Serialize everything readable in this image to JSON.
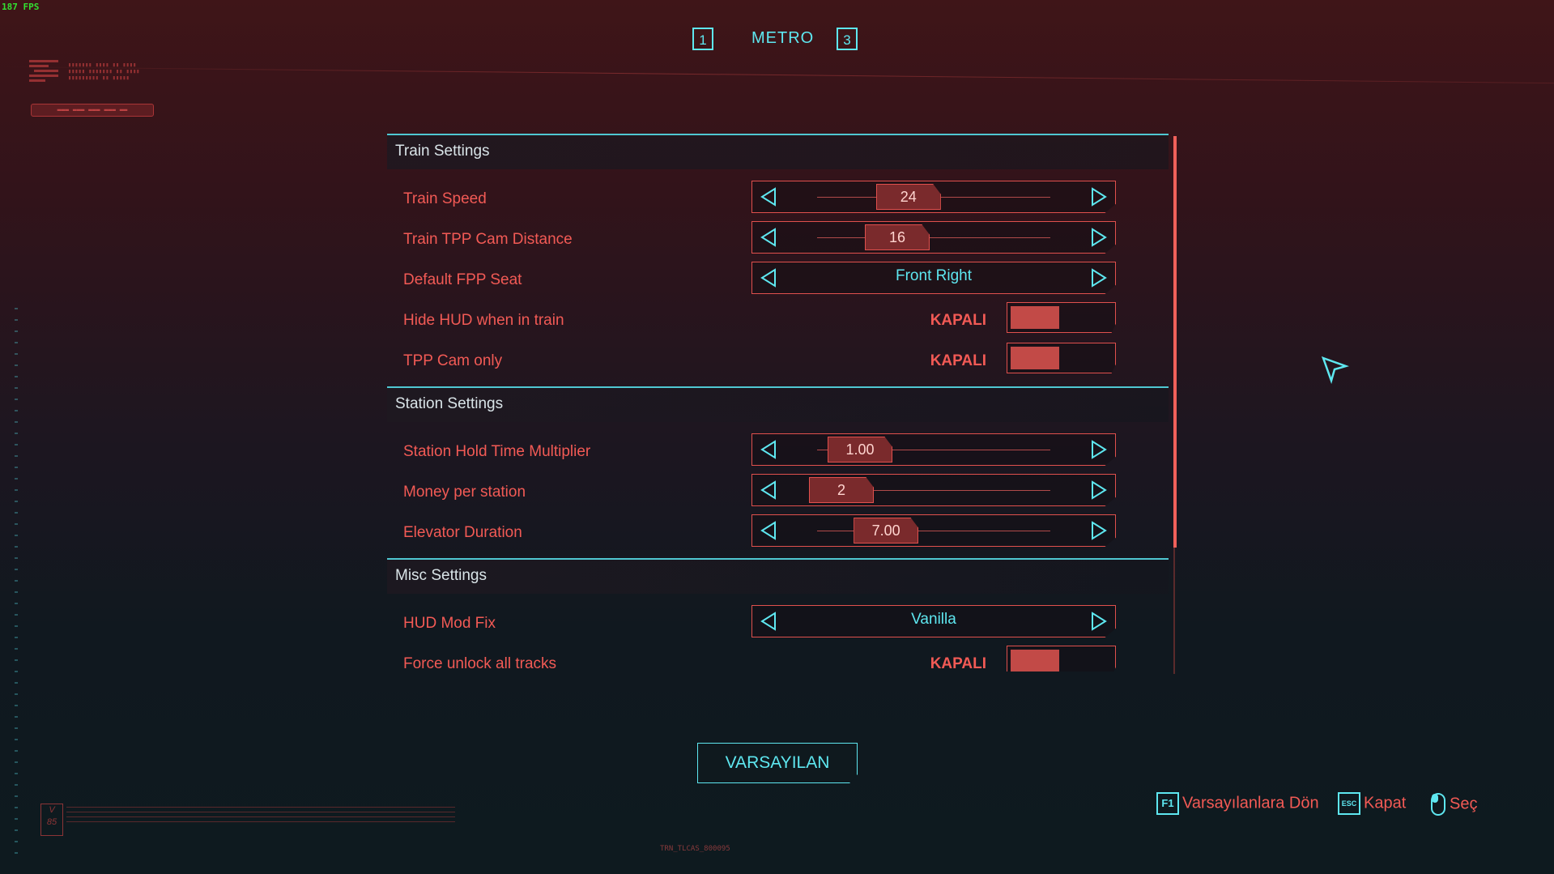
{
  "overlay": {
    "fps": "187 FPS"
  },
  "tabs": {
    "prev_key": "1",
    "title": "METRO",
    "next_key": "3"
  },
  "sections": {
    "train": {
      "title": "Train Settings",
      "rows": {
        "train_speed": {
          "label": "Train Speed",
          "value": "24",
          "fraction": 0.36
        },
        "tpp_cam": {
          "label": "Train TPP Cam Distance",
          "value": "16",
          "fraction": 0.3
        },
        "fpp_seat": {
          "label": "Default FPP Seat",
          "value": "Front Right",
          "selected_index": 0,
          "option_count": 3
        },
        "hide_hud": {
          "label": "Hide HUD when in train",
          "value": "KAPALI"
        },
        "tpp_only": {
          "label": "TPP Cam only",
          "value": "KAPALI"
        }
      }
    },
    "station": {
      "title": "Station Settings",
      "rows": {
        "hold_time": {
          "label": "Station Hold Time Multiplier",
          "value": "1.00",
          "fraction": 0.1
        },
        "money": {
          "label": "Money per station",
          "value": "2",
          "fraction": 0.0
        },
        "elevator": {
          "label": "Elevator Duration",
          "value": "7.00",
          "fraction": 0.24
        }
      }
    },
    "misc": {
      "title": "Misc Settings",
      "rows": {
        "hud_fix": {
          "label": "HUD Mod Fix",
          "value": "Vanilla",
          "selected_index": 0,
          "option_count": 3
        },
        "unlock_tracks": {
          "label": "Force unlock all tracks",
          "value": "KAPALI"
        }
      }
    }
  },
  "footer": {
    "default_button": "VARSAYILAN",
    "hints": [
      {
        "key": "F1",
        "label": "Varsayılanlara Dön"
      },
      {
        "key": "ESC",
        "label": "Kapat"
      },
      {
        "key": "mouse",
        "label": "Seç"
      }
    ],
    "bottom_code": "TRN_TLCAS_800095"
  },
  "colors": {
    "accent_cyan": "#5ee7f0",
    "accent_red": "#f25a55",
    "toggle_off": "#c24a47"
  }
}
